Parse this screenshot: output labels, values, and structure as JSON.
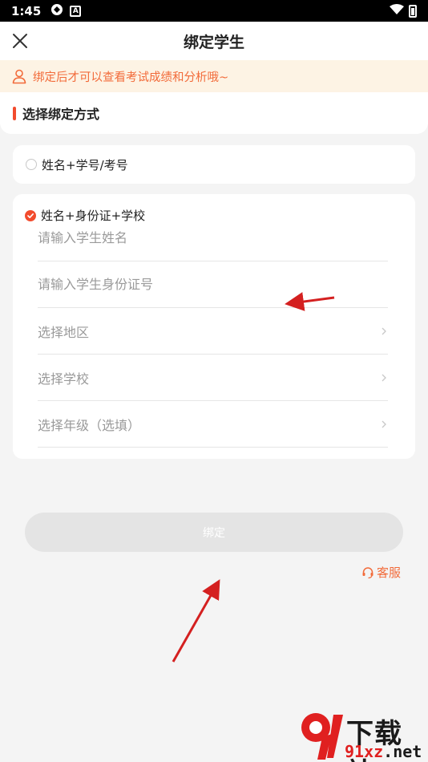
{
  "status_bar": {
    "time": "1:45",
    "a_icon": "A"
  },
  "nav": {
    "title": "绑定学生"
  },
  "notice": {
    "text": "绑定后才可以查看考试成绩和分析哦~"
  },
  "section": {
    "title": "选择绑定方式"
  },
  "options": {
    "option1": {
      "label": "姓名+学号/考号",
      "selected": false
    },
    "option2": {
      "label": "姓名+身份证+学校",
      "selected": true
    }
  },
  "form": {
    "name_placeholder": "请输入学生姓名",
    "id_placeholder": "请输入学生身份证号",
    "region_label": "选择地区",
    "school_label": "选择学校",
    "grade_label": "选择年级（选填）"
  },
  "actions": {
    "bind_label": "绑定",
    "service_label": "客服"
  },
  "watermark": {
    "title": "下载站",
    "url_prefix": "91xz",
    "url_suffix": ".net"
  },
  "colors": {
    "accent": "#f24b2d",
    "notice_bg": "#fdf3e4",
    "notice_text": "#f26b3a",
    "button_disabled": "#e4e4e4"
  }
}
